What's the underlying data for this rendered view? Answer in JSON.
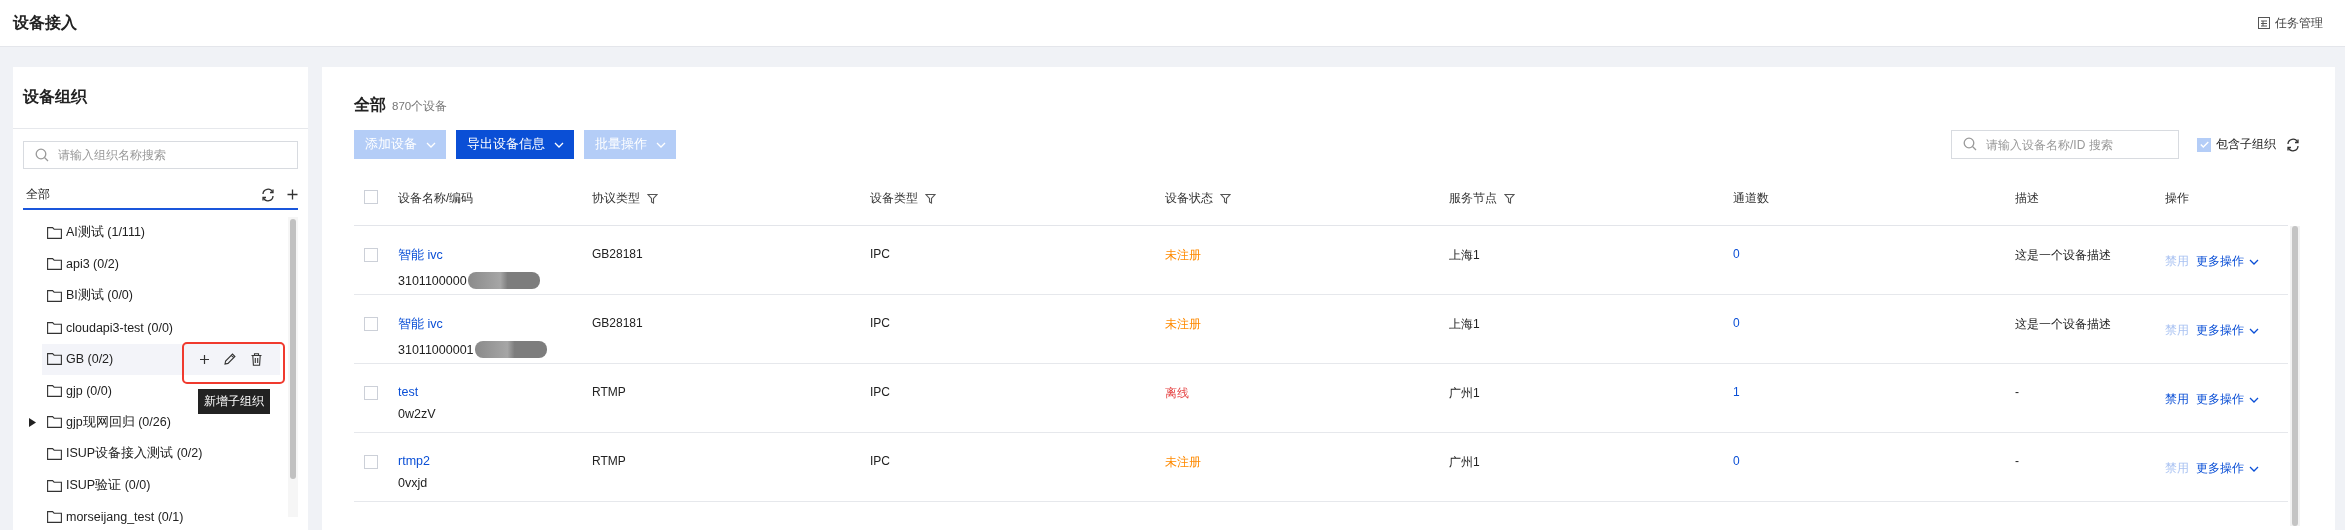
{
  "page": {
    "title": "设备接入",
    "task_link": "任务管理"
  },
  "groups_panel": {
    "title": "设备组织",
    "search": {
      "placeholder": "请输入组织名称搜索"
    },
    "root_label": "全部",
    "items": [
      {
        "label": "AI测试 (1/111)",
        "expandable": false,
        "hovered": false
      },
      {
        "label": "api3 (0/2)",
        "expandable": false,
        "hovered": false
      },
      {
        "label": "BI测试 (0/0)",
        "expandable": false,
        "hovered": false
      },
      {
        "label": "cloudapi3-test (0/0)",
        "expandable": false,
        "hovered": false
      },
      {
        "label": "GB (0/2)",
        "expandable": false,
        "hovered": true,
        "tooltip": "新增子组织"
      },
      {
        "label": "gjp (0/0)",
        "expandable": false,
        "hovered": false
      },
      {
        "label": "gjp现网回归 (0/26)",
        "expandable": true,
        "hovered": false
      },
      {
        "label": "ISUP设备接入测试 (0/2)",
        "expandable": false,
        "hovered": false
      },
      {
        "label": "ISUP验证 (0/0)",
        "expandable": false,
        "hovered": false
      },
      {
        "label": "morseijang_test (0/1)",
        "expandable": false,
        "hovered": false
      }
    ]
  },
  "devices_panel": {
    "title": "全部",
    "count": "870个设备",
    "buttons": [
      {
        "label": "添加设备",
        "disabled": true
      },
      {
        "label": "导出设备信息",
        "disabled": false
      },
      {
        "label": "批量操作",
        "disabled": true
      }
    ],
    "search": {
      "placeholder": "请输入设备名称/ID 搜索"
    },
    "include_subgroups": {
      "label": "包含子组织",
      "checked": true
    },
    "table": {
      "header_checked": false,
      "columns": [
        {
          "label": "设备名称/编码",
          "filter": false
        },
        {
          "label": "协议类型",
          "filter": true
        },
        {
          "label": "设备类型",
          "filter": true
        },
        {
          "label": "设备状态",
          "filter": true
        },
        {
          "label": "服务节点",
          "filter": true
        },
        {
          "label": "通道数",
          "filter": false
        },
        {
          "label": "描述",
          "filter": false
        },
        {
          "label": "操作",
          "filter": false
        }
      ],
      "rows": [
        {
          "checked": false,
          "name": "智能 ivc",
          "code": "3101100000",
          "redacted": true,
          "protocol": "GB28181",
          "type": "IPC",
          "status": "未注册",
          "color": "#ff8a00",
          "node": "上海1",
          "channels": "0",
          "description": "这是一个设备描述",
          "disable": {
            "label": "禁用",
            "disabled": true
          },
          "more": "更多操作"
        },
        {
          "checked": false,
          "name": "智能 ivc",
          "code": "31011000001",
          "redacted": true,
          "protocol": "GB28181",
          "type": "IPC",
          "status": "未注册",
          "color": "#ff8a00",
          "node": "上海1",
          "channels": "0",
          "description": "这是一个设备描述",
          "disable": {
            "label": "禁用",
            "disabled": true
          },
          "more": "更多操作"
        },
        {
          "checked": false,
          "name": "test",
          "code": "0w2zV",
          "redacted": false,
          "protocol": "RTMP",
          "type": "IPC",
          "status": "离线",
          "color": "#e54545",
          "node": "广州1",
          "channels": "1",
          "description": "-",
          "disable": {
            "label": "禁用",
            "disabled": false
          },
          "more": "更多操作"
        },
        {
          "checked": false,
          "name": "rtmp2",
          "code": "0vxjd",
          "redacted": false,
          "protocol": "RTMP",
          "type": "IPC",
          "status": "未注册",
          "color": "#ff8a00",
          "node": "广州1",
          "channels": "0",
          "description": "-",
          "disable": {
            "label": "禁用",
            "disabled": true
          },
          "more": "更多操作"
        }
      ]
    }
  }
}
